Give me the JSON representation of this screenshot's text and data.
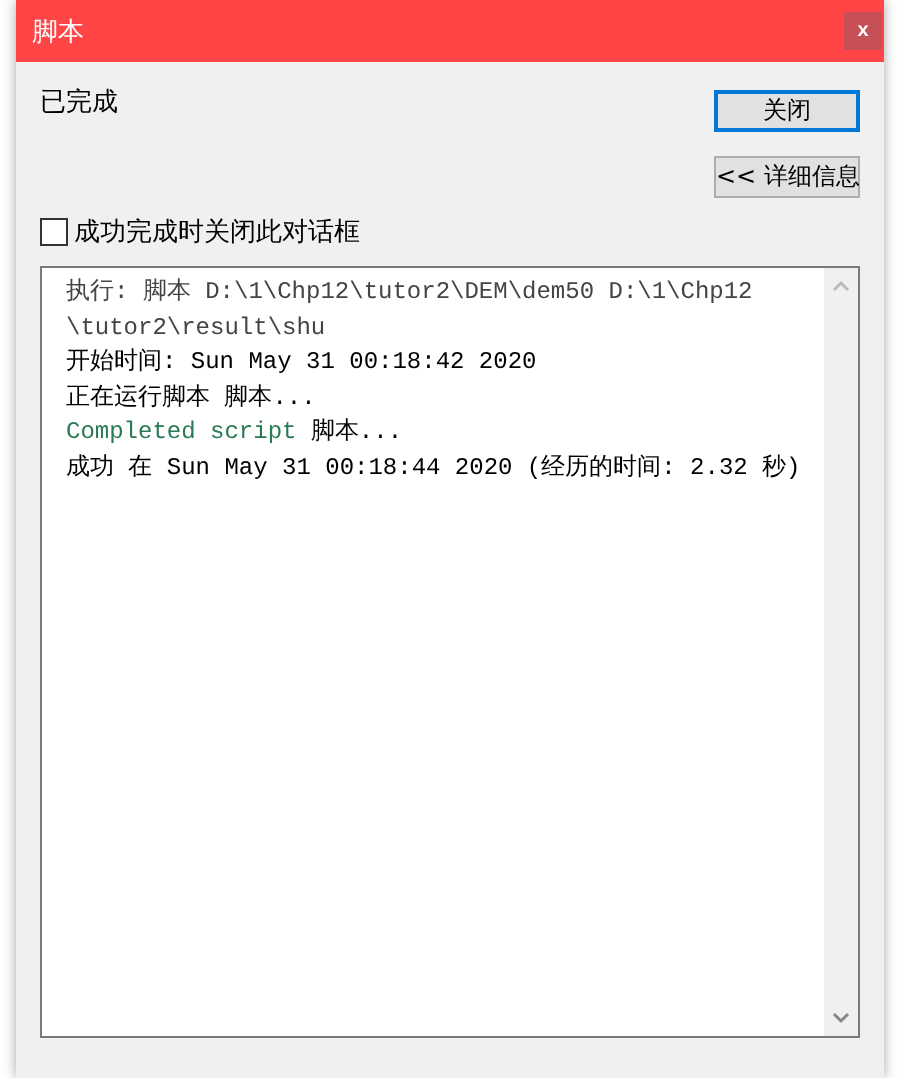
{
  "window": {
    "title": "脚本",
    "close": "x"
  },
  "status": "已完成",
  "buttons": [
    {
      "label": "关闭",
      "focused": true
    },
    {
      "label": "<< 详细信息",
      "focused": false
    }
  ],
  "close_on_success": {
    "label": "成功完成时关闭此对话框",
    "checked": false
  },
  "log": [
    {
      "segments": [
        {
          "text": "执行: 脚本 D:\\1\\Chp12\\tutor2\\DEM\\dem50 D:\\1\\Chp12",
          "color": "#444444"
        }
      ]
    },
    {
      "segments": [
        {
          "text": "\\tutor2\\result\\shu",
          "color": "#444444"
        }
      ]
    },
    {
      "segments": [
        {
          "text": "开始时间: Sun May 31 00:18:42 2020",
          "color": "#000000"
        }
      ]
    },
    {
      "segments": [
        {
          "text": "正在运行脚本 脚本...",
          "color": "#000000"
        }
      ]
    },
    {
      "segments": [
        {
          "text": "Completed script",
          "color": "#2a7a55"
        },
        {
          "text": " 脚本...",
          "color": "#000000"
        }
      ]
    },
    {
      "segments": [
        {
          "text": "成功 在 Sun May 31 00:18:44 2020 (经历的时间: 2.32 秒)",
          "color": "#000000"
        }
      ]
    }
  ]
}
